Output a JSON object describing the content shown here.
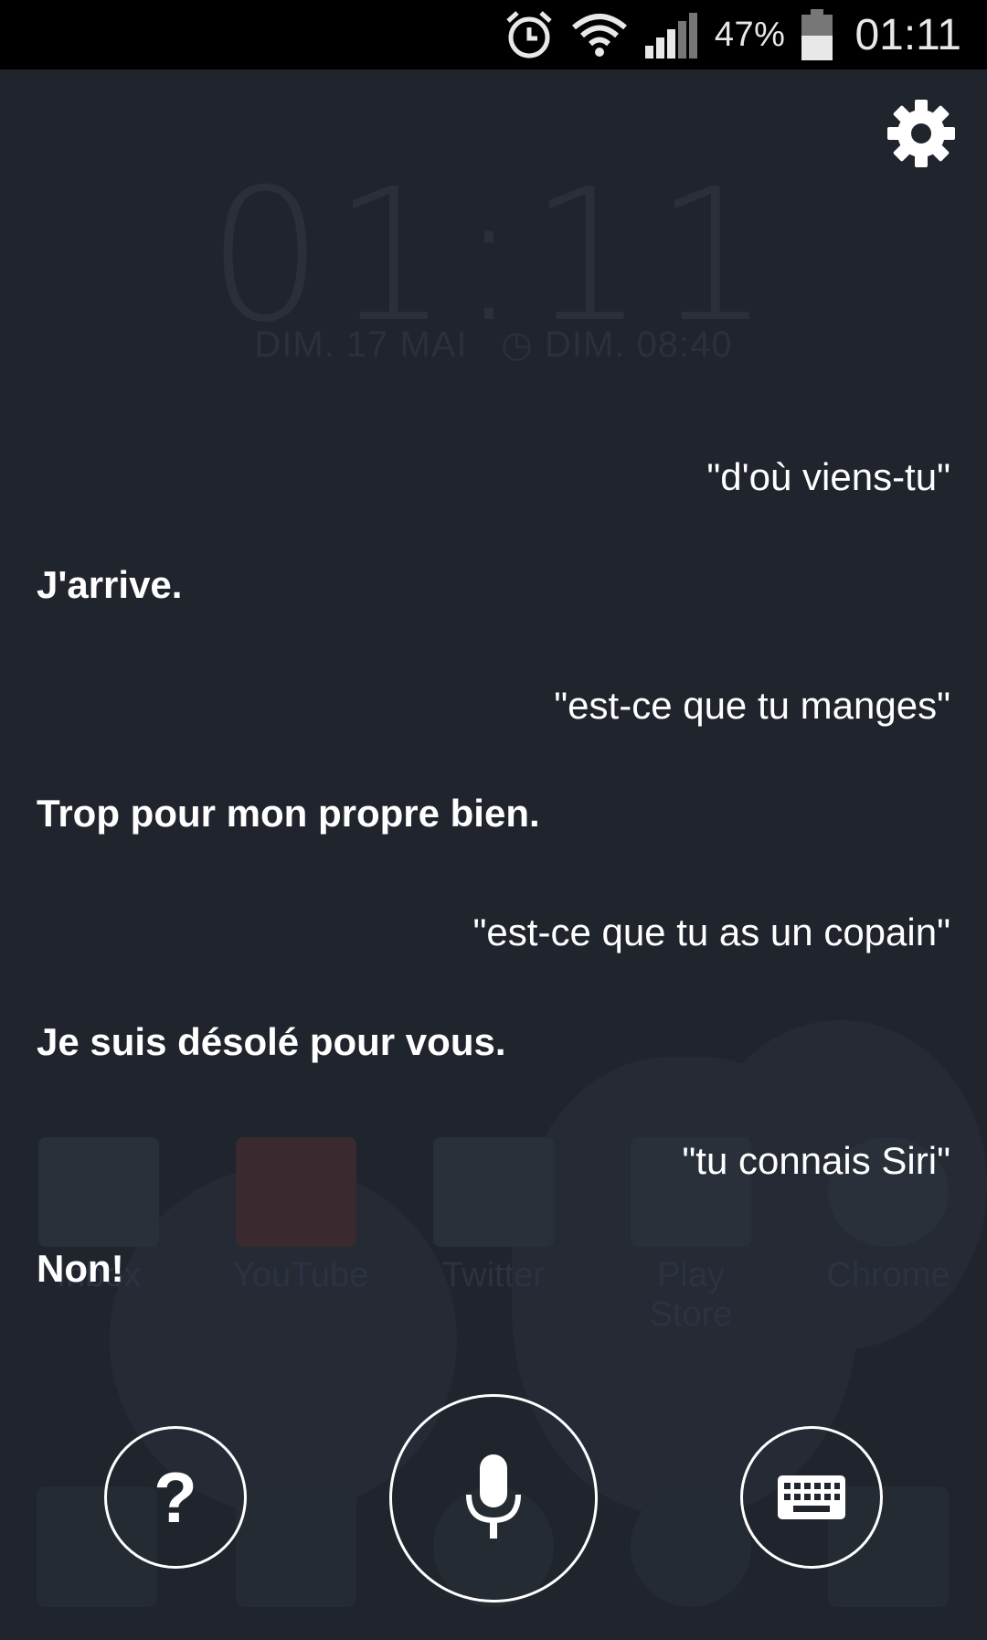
{
  "status_bar": {
    "battery_percent": "47%",
    "time": "01:11",
    "icons": [
      "alarm-icon",
      "wifi-icon",
      "signal-icon",
      "battery-icon"
    ]
  },
  "background": {
    "clock": "01:11",
    "date": "DIM. 17 MAI",
    "alarm": "DIM. 08:40",
    "apps": [
      "Inbox",
      "YouTube",
      "Twitter",
      "Play Store",
      "Chrome"
    ]
  },
  "conversation": [
    {
      "role": "user",
      "text": "\"d'où viens-tu\""
    },
    {
      "role": "assistant",
      "text": "J'arrive."
    },
    {
      "role": "user",
      "text": "\"est-ce que tu manges\""
    },
    {
      "role": "assistant",
      "text": "Trop pour mon propre bien."
    },
    {
      "role": "user",
      "text": "\"est-ce que tu as un copain\""
    },
    {
      "role": "assistant",
      "text": "Je suis désolé pour vous."
    },
    {
      "role": "user",
      "text": "\"tu connais Siri\""
    },
    {
      "role": "assistant",
      "text": "Non!"
    }
  ],
  "controls": {
    "help_label": "?",
    "mic_icon": "microphone-icon",
    "keyboard_icon": "keyboard-icon",
    "settings_icon": "gear-icon"
  }
}
